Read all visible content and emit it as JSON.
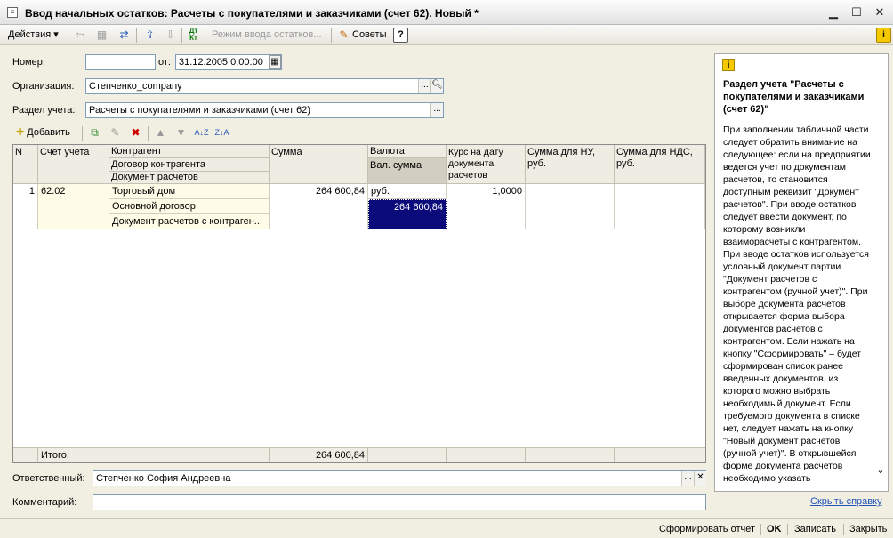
{
  "window": {
    "title": "Ввод начальных остатков: Расчеты с покупателями и заказчиками (счет 62). Новый *"
  },
  "toolbar": {
    "actions_label": "Действия",
    "mode_label": "Режим ввода остатков...",
    "advice_label": "Советы",
    "help_btn": "?",
    "dt_kt": "Дт Кт"
  },
  "form": {
    "number_label": "Номер:",
    "number_value": "",
    "from_label": "от:",
    "date_value": "31.12.2005  0:00:00",
    "org_label": "Организация:",
    "org_value": "Степченко_company",
    "section_label": "Раздел учета:",
    "section_value": "Расчеты с покупателями и заказчиками (счет 62)",
    "ellipsis": "...",
    "responsible_label": "Ответственный:",
    "responsible_value": "Степченко София Андреевна",
    "comment_label": "Комментарий:",
    "comment_value": ""
  },
  "table_toolbar": {
    "add_label": "Добавить"
  },
  "table": {
    "headers": {
      "n": "N",
      "account": "Счет учета",
      "contractor": "Контрагент",
      "contract": "Договор контрагента",
      "document": "Документ расчетов",
      "sum": "Сумма",
      "currency": "Валюта",
      "cur_sum": "Вал. сумма",
      "rate": "Курс на дату документа расчетов",
      "sum_nu": "Сумма для НУ, руб.",
      "sum_nds": "Сумма для НДС, руб."
    },
    "rows": [
      {
        "n": "1",
        "account": "62.02",
        "contractor": "Торговый дом",
        "contract": "Основной договор",
        "document": "Документ расчетов с контраген...",
        "sum": "264 600,84",
        "currency": "руб.",
        "cur_sum": "264 600,84",
        "rate": "1,0000",
        "sum_nu": "",
        "sum_nds": ""
      }
    ],
    "footer": {
      "total_label": "Итого:",
      "total_sum": "264 600,84"
    }
  },
  "help": {
    "icon": "i",
    "title": "Раздел учета \"Расчеты с покупателями и заказчиками (счет 62)\"",
    "body": "При заполнении табличной части следует обратить внимание на следующее: если на предприятии ведется учет по документам расчетов, то становится доступным реквизит \"Документ расчетов\". При вводе остатков следует ввести документ, по которому возникли взаиморасчеты с контрагентом. При вводе остатков используется условный документ партии \"Документ расчетов с контрагентом (ручной учет)\". При выборе документа расчетов открывается форма выбора документов расчетов с контрагентом. Если нажать на кнопку \"Сформировать\" – будет сформирован список ранее введенных документов, из которого можно выбрать необходимый документ. Если требуемого документа в списке нет, следует нажать на кнопку \"Новый документ расчетов (ручной учет)\". В открывшейся форме документа расчетов необходимо указать",
    "hide_link": "Скрыть справку"
  },
  "status": {
    "report_btn": "Сформировать отчет",
    "ok_btn": "OK",
    "save_btn": "Записать",
    "close_btn": "Закрыть"
  },
  "colors": {
    "selection": "#0a0a7a",
    "link": "#2354b7",
    "help_icon": "#f5c800"
  }
}
